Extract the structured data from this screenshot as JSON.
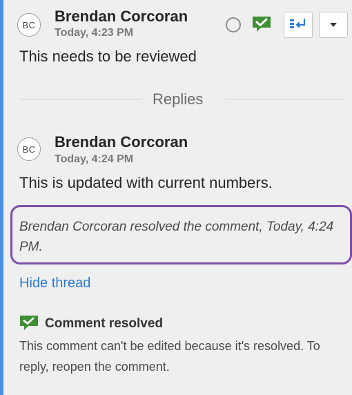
{
  "comment": {
    "avatar_initials": "BC",
    "author": "Brendan Corcoran",
    "timestamp": "Today, 4:23 PM",
    "text": "This needs to be reviewed"
  },
  "replies_label": "Replies",
  "reply": {
    "avatar_initials": "BC",
    "author": "Brendan Corcoran",
    "timestamp": "Today, 4:24 PM",
    "text": "This is updated with current numbers."
  },
  "resolved_note": "Brendan Corcoran resolved the comment, Today, 4:24 PM.",
  "hide_thread_label": "Hide thread",
  "status": {
    "title": "Comment resolved",
    "description": "This comment can't be edited because it's resolved. To reply, reopen the comment."
  },
  "icons": {
    "toggle": "circle-toggle-icon",
    "resolved": "checkmark-comment-icon",
    "jump": "jump-to-cell-icon",
    "menu": "caret-down-icon"
  },
  "colors": {
    "accent_bar": "#4a90e2",
    "resolved_green": "#3f8f35",
    "link_blue": "#2a7bd4",
    "highlight_purple": "#7b4fa8"
  }
}
